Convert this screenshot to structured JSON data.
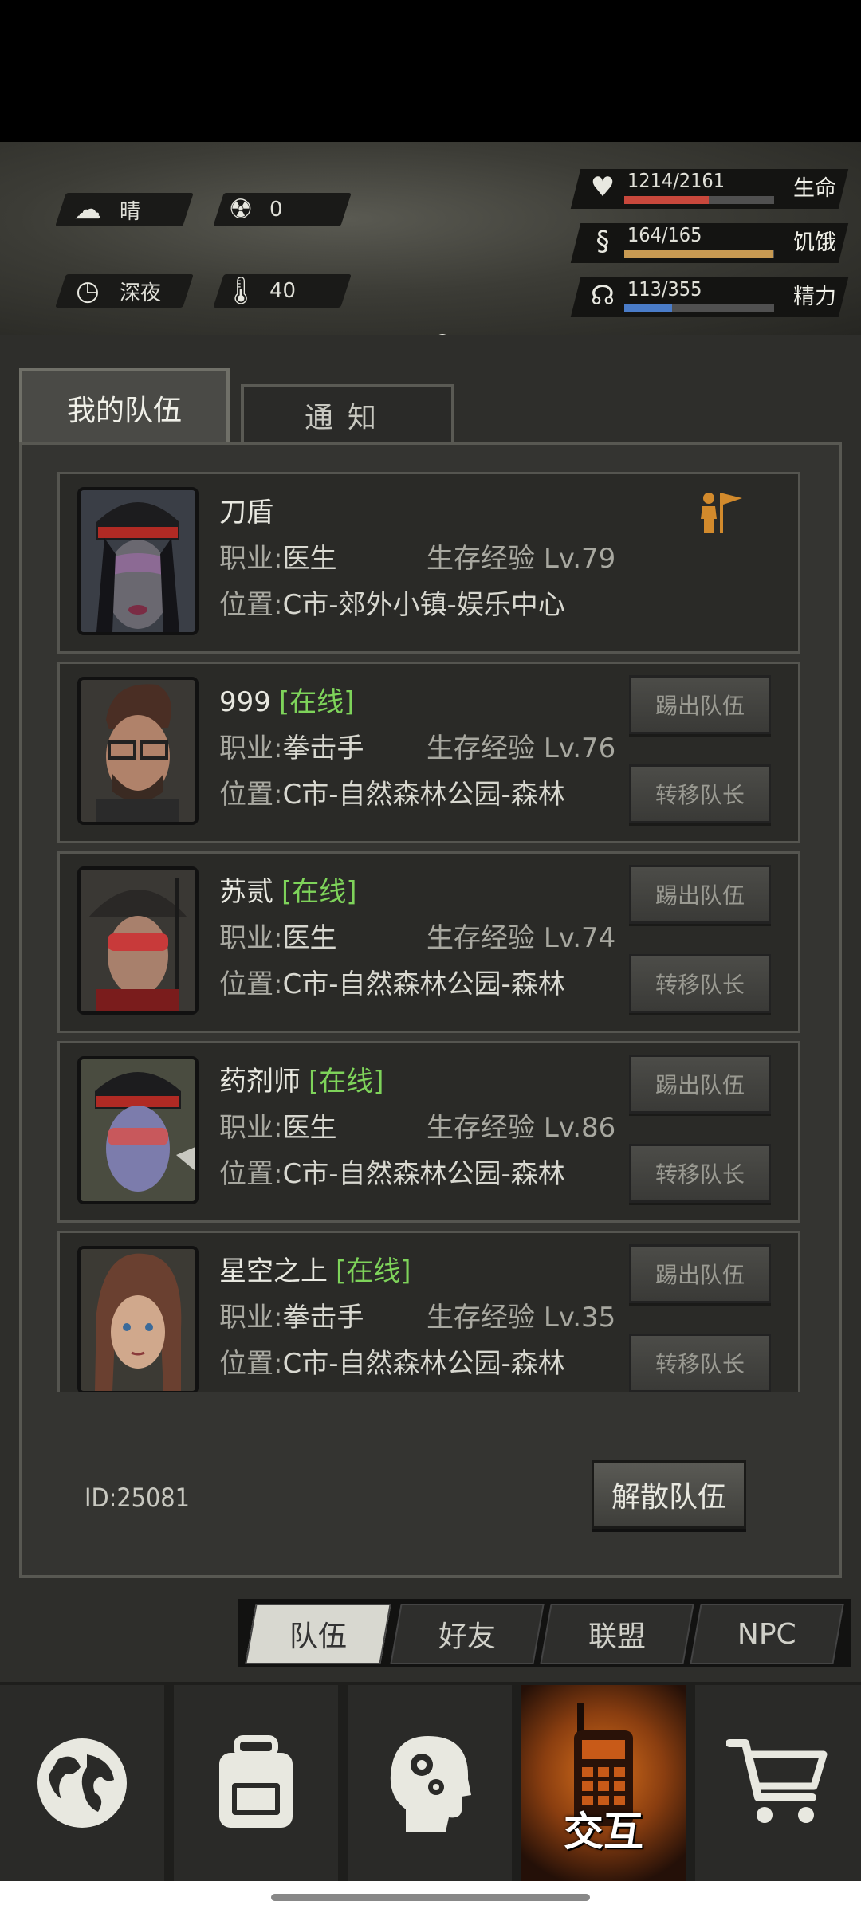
{
  "status": {
    "weather": {
      "icon": "cloud-sun-icon",
      "label": "晴"
    },
    "radiation": {
      "icon": "radiation-icon",
      "value": "0"
    },
    "time": {
      "icon": "clock-icon",
      "label": "深夜"
    },
    "temperature": {
      "icon": "thermometer-icon",
      "value": "40"
    },
    "bars": [
      {
        "name": "生命",
        "value": "1214/2161",
        "fraction": 0.562,
        "color": "#c8483c",
        "icon": "heart-icon"
      },
      {
        "name": "饥饿",
        "value": "164/165",
        "fraction": 0.994,
        "color": "#c89a52",
        "icon": "stomach-icon"
      },
      {
        "name": "精力",
        "value": "113/355",
        "fraction": 0.318,
        "color": "#4a7cc8",
        "icon": "brain-icon"
      }
    ]
  },
  "tabs": {
    "my_team": "我的队伍",
    "notice": "通知"
  },
  "labels": {
    "job": "职业:",
    "exp": "生存经验 ",
    "location": "位置:",
    "kick": "踢出队伍",
    "transfer": "转移队长"
  },
  "members": [
    {
      "name": "刀盾",
      "online": "",
      "job": "医生",
      "level": "Lv.79",
      "location": "C市-郊外小镇-娱乐中心",
      "leader": true
    },
    {
      "name": "999",
      "online": "[在线]",
      "job": "拳击手",
      "level": "Lv.76",
      "location": "C市-自然森林公园-森林"
    },
    {
      "name": "苏贰",
      "online": "[在线]",
      "job": "医生",
      "level": "Lv.74",
      "location": "C市-自然森林公园-森林"
    },
    {
      "name": "药剂师",
      "online": "[在线]",
      "job": "医生",
      "level": "Lv.86",
      "location": "C市-自然森林公园-森林"
    },
    {
      "name": "星空之上",
      "online": "[在线]",
      "job": "拳击手",
      "level": "Lv.35",
      "location": "C市-自然森林公园-森林"
    }
  ],
  "team_id": "ID:25081",
  "disband": "解散队伍",
  "subtabs": [
    "队伍",
    "好友",
    "联盟",
    "NPC"
  ],
  "nav": [
    {
      "icon": "globe-icon"
    },
    {
      "icon": "backpack-icon"
    },
    {
      "icon": "head-gears-icon"
    },
    {
      "icon": "walkie-talkie-icon",
      "label": "交互"
    },
    {
      "icon": "cart-icon"
    }
  ]
}
